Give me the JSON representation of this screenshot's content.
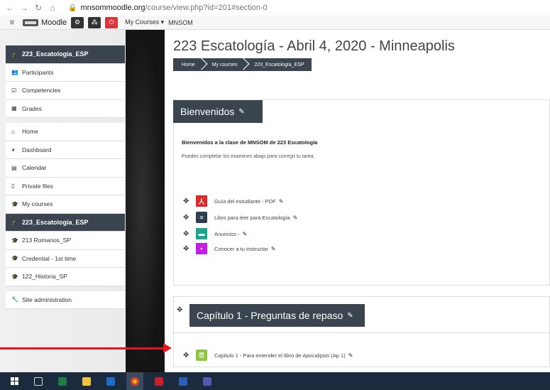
{
  "browser": {
    "url_host": "mnsommoodle.org",
    "url_path": "/course/view.php?id=201#section-0"
  },
  "navbar": {
    "brand": "Moodle",
    "my_courses": "My Courses",
    "current": "MNSOM"
  },
  "drawer": {
    "items": [
      {
        "label": "223_Escatología_ESP",
        "icon": "graduation-cap-icon",
        "active": true
      },
      {
        "label": "Participants",
        "icon": "users-icon"
      },
      {
        "label": "Competencies",
        "icon": "check-square-icon"
      },
      {
        "label": "Grades",
        "icon": "table-icon"
      },
      {
        "label": "Home",
        "icon": "home-icon"
      },
      {
        "label": "Dashboard",
        "icon": "dashboard-icon"
      },
      {
        "label": "Calendar",
        "icon": "calendar-icon"
      },
      {
        "label": "Private files",
        "icon": "file-icon"
      },
      {
        "label": "My courses",
        "icon": "graduation-cap-icon"
      },
      {
        "label": "223_Escatología_ESP",
        "icon": "graduation-cap-icon",
        "active": true
      },
      {
        "label": "213 Romanos_SP",
        "icon": "graduation-cap-icon"
      },
      {
        "label": "Credential - 1st time",
        "icon": "graduation-cap-icon"
      },
      {
        "label": "122_Historia_SP",
        "icon": "graduation-cap-icon"
      },
      {
        "label": "Site administration",
        "icon": "wrench-icon"
      }
    ]
  },
  "main": {
    "title": "223 Escatología - Abril 4, 2020 - Minneapolis",
    "breadcrumbs": [
      "Home",
      "My courses",
      "223_Escatología_ESP"
    ],
    "section0": {
      "heading": "Bienvenidos",
      "welcome_bold": "Bienvenidos a la clase de MNSOM de 223 Escatología",
      "welcome_text": "Puedes completar los examines abajo para corregir tu tarea.",
      "activities": [
        {
          "label": "Guía del estudiante - PDF",
          "icon": "pdf-icon",
          "color": "#e02828"
        },
        {
          "label": "Libro para leer para Escatología",
          "icon": "document-icon",
          "color": "#2d3e50"
        },
        {
          "label": "Anuncios -",
          "icon": "forum-icon",
          "color": "#1aa78e"
        },
        {
          "label": "Conocer a tu instructor",
          "icon": "page-icon",
          "color": "#c21fe0"
        }
      ]
    },
    "section1": {
      "heading": "Capítulo 1 - Preguntas de repaso",
      "activities": [
        {
          "label": "Capitulo 1 - Para entender el libro de Apocalipsis (Ap 1)",
          "icon": "quiz-icon",
          "color": "#8cc63f"
        }
      ]
    }
  }
}
